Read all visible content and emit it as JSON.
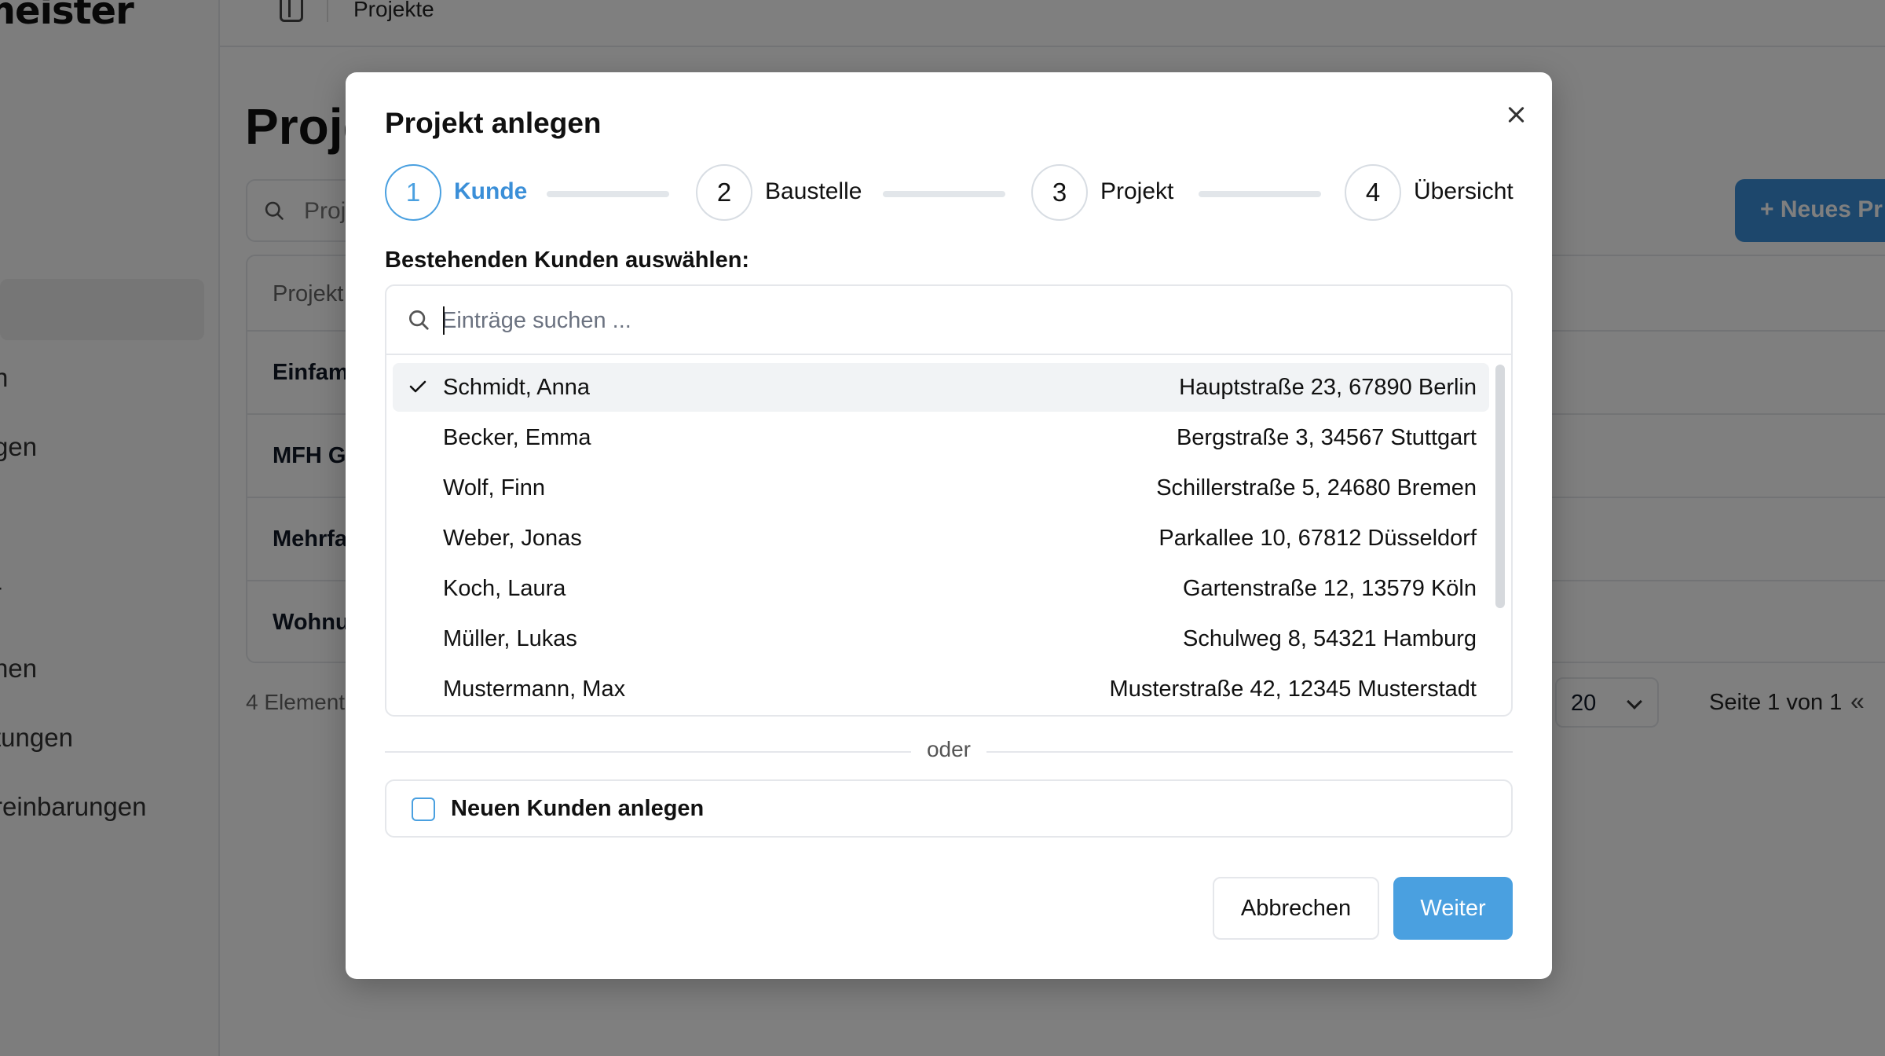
{
  "app": {
    "brand": "meister",
    "breadcrumb": "Projekte",
    "page_title": "Projekte",
    "search_placeholder": "Proj",
    "new_button": "Neues Pr",
    "sidebar_items": [
      "n",
      "gen",
      "-",
      "nen",
      "tungen",
      "reinbarungen"
    ],
    "table": {
      "header": "Projekt",
      "rows": [
        "Einfam",
        "MFH Gr",
        "Mehrfa",
        "Wohnu"
      ]
    },
    "footer": {
      "count": "4 Element",
      "per_page": "20",
      "page_info": "Seite 1 von 1",
      "first_page": "«"
    }
  },
  "dialog": {
    "title": "Projekt anlegen",
    "steps": [
      {
        "number": "1",
        "label": "Kunde",
        "active": true
      },
      {
        "number": "2",
        "label": "Baustelle",
        "active": false
      },
      {
        "number": "3",
        "label": "Projekt",
        "active": false
      },
      {
        "number": "4",
        "label": "Übersicht",
        "active": false
      }
    ],
    "select_label": "Bestehenden Kunden auswählen:",
    "search": {
      "placeholder": "Einträge suchen ...",
      "value": ""
    },
    "customers": [
      {
        "name": "Schmidt, Anna",
        "address": "Hauptstraße 23, 67890 Berlin",
        "selected": true
      },
      {
        "name": "Becker, Emma",
        "address": "Bergstraße 3, 34567 Stuttgart",
        "selected": false
      },
      {
        "name": "Wolf, Finn",
        "address": "Schillerstraße 5, 24680 Bremen",
        "selected": false
      },
      {
        "name": "Weber, Jonas",
        "address": "Parkallee 10, 67812 Düsseldorf",
        "selected": false
      },
      {
        "name": "Koch, Laura",
        "address": "Gartenstraße 12, 13579 Köln",
        "selected": false
      },
      {
        "name": "Müller, Lukas",
        "address": "Schulweg 8, 54321 Hamburg",
        "selected": false
      },
      {
        "name": "Mustermann, Max",
        "address": "Musterstraße 42, 12345 Musterstadt",
        "selected": false
      }
    ],
    "divider_text": "oder",
    "new_customer": {
      "label": "Neuen Kunden anlegen",
      "checked": false
    },
    "buttons": {
      "cancel": "Abbrechen",
      "next": "Weiter"
    },
    "colors": {
      "accent": "#4aa0e0",
      "overlay": "rgba(0,0,0,0.5)",
      "selected_row": "#f1f3f5"
    }
  }
}
